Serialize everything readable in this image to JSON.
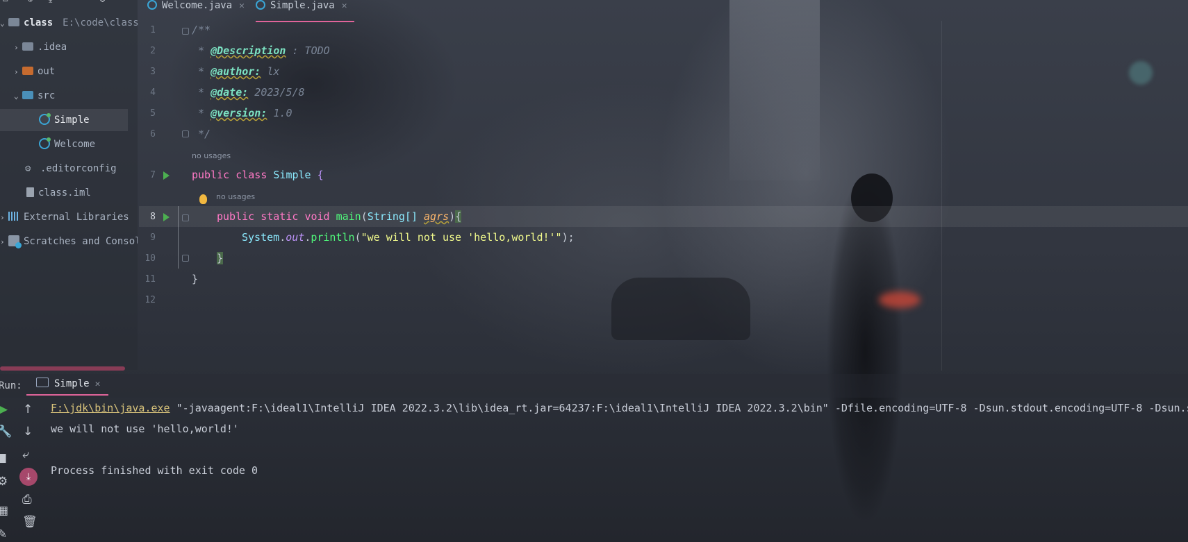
{
  "project": {
    "root_name": "class",
    "root_path": "E:\\code\\class",
    "items": [
      {
        "label": ".idea"
      },
      {
        "label": "out"
      },
      {
        "label": "src"
      },
      {
        "label": "Simple"
      },
      {
        "label": "Welcome"
      },
      {
        "label": ".editorconfig"
      },
      {
        "label": "class.iml"
      },
      {
        "label": "External Libraries"
      },
      {
        "label": "Scratches and Consoles"
      }
    ]
  },
  "tabs": [
    {
      "label": "Welcome.java"
    },
    {
      "label": "Simple.java"
    }
  ],
  "editor": {
    "line_numbers": [
      "1",
      "2",
      "3",
      "4",
      "5",
      "6",
      "7",
      "8",
      "9",
      "10",
      "11",
      "12"
    ],
    "hint_no_usages": "no usages",
    "lines": {
      "l1": "/**",
      "l2_star": " * ",
      "l2_tag": "@Description",
      "l2_rest": " : TODO",
      "l3_star": " * ",
      "l3_tag": "@author:",
      "l3_rest": " lx",
      "l4_star": " * ",
      "l4_tag": "@date:",
      "l4_rest": " 2023/5/8",
      "l5_star": " * ",
      "l5_tag": "@version:",
      "l5_rest": " 1.0",
      "l6": " */",
      "l7_kw1": "public",
      "l7_kw2": "class",
      "l7_name": "Simple",
      "l7_brace": " {",
      "l8_kw1": "public",
      "l8_kw2": "static",
      "l8_kw3": "void",
      "l8_fn": "main",
      "l8_p1": "(",
      "l8_type": "String[]",
      "l8_param": "agrs",
      "l8_p2": ")",
      "l8_brace": "{",
      "l9_cls": "System",
      "l9_dot1": ".",
      "l9_fld": "out",
      "l9_dot2": ".",
      "l9_fn": "println",
      "l9_p1": "(",
      "l9_str": "\"we will not use 'hello,world!'\"",
      "l9_end": ");",
      "l10": "}",
      "l11": "}"
    }
  },
  "run": {
    "label": "Run:",
    "tab": "Simple",
    "output": {
      "java_path": "F:\\jdk\\bin\\java.exe",
      "args": " \"-javaagent:F:\\ideal1\\IntelliJ IDEA 2022.3.2\\lib\\idea_rt.jar=64237:F:\\ideal1\\IntelliJ IDEA 2022.3.2\\bin\" -Dfile.encoding=UTF-8 -Dsun.stdout.encoding=UTF-8 -Dsun.s",
      "line2": "we will not use 'hello,world!'",
      "line3": "Process finished with exit code 0"
    }
  },
  "colors": {
    "accent_underline": "#e0649a",
    "keyword": "#ff79c6",
    "class": "#8be9fd",
    "function": "#50fa7b",
    "string": "#f1fa8c"
  }
}
